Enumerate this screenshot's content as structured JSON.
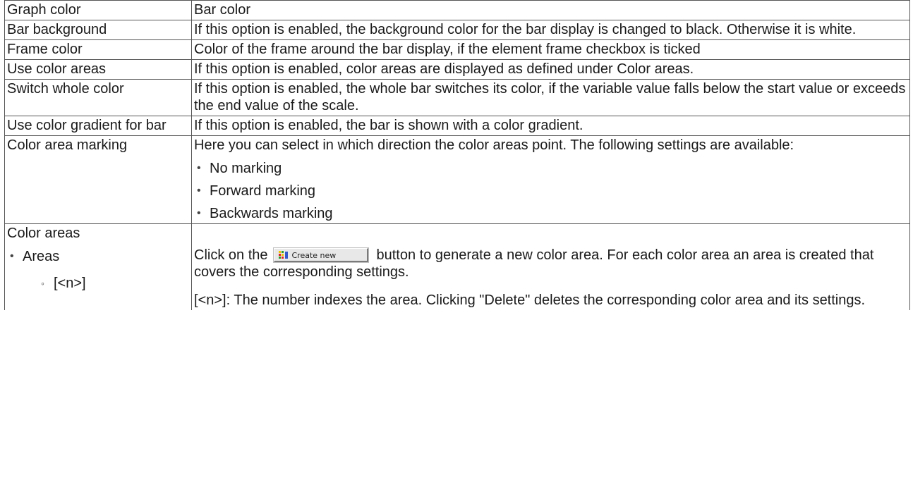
{
  "rows": [
    {
      "label": "Graph color",
      "desc": "Bar color"
    },
    {
      "label": "Bar background",
      "desc": "If this option is enabled, the background color for the bar display is changed to black. Otherwise it is white."
    },
    {
      "label": "Frame color",
      "desc": "Color of the frame around the bar display, if the element frame checkbox is ticked"
    },
    {
      "label": "Use color areas",
      "desc": "If this option is enabled, color areas are displayed as defined under Color areas."
    },
    {
      "label": "Switch whole color",
      "desc": "If this option is enabled, the whole bar switches its color, if the variable value falls below the start value or exceeds the end value of the scale."
    },
    {
      "label": "Use color gradient for bar",
      "desc": "If this option is enabled, the bar is shown with a color gradient."
    },
    {
      "label": "Color area marking",
      "desc": "Here you can select in which direction the color areas point. The following settings are available:",
      "options": [
        "No marking",
        "Forward marking",
        "Backwards marking"
      ]
    },
    {
      "label": "Color areas",
      "sub_label": "Areas",
      "sub_sub_label": "[<n>]",
      "desc_before_button": "Click on the",
      "button_label": "Create new",
      "desc_after_button": "button to generate a new color area. For each color area an area is created that covers the corresponding settings.",
      "note": "[<n>]: The number indexes the area. Clicking \"Delete\" deletes the corresponding color area and its settings."
    }
  ],
  "icon": {
    "create_new": "color-area-icon"
  }
}
